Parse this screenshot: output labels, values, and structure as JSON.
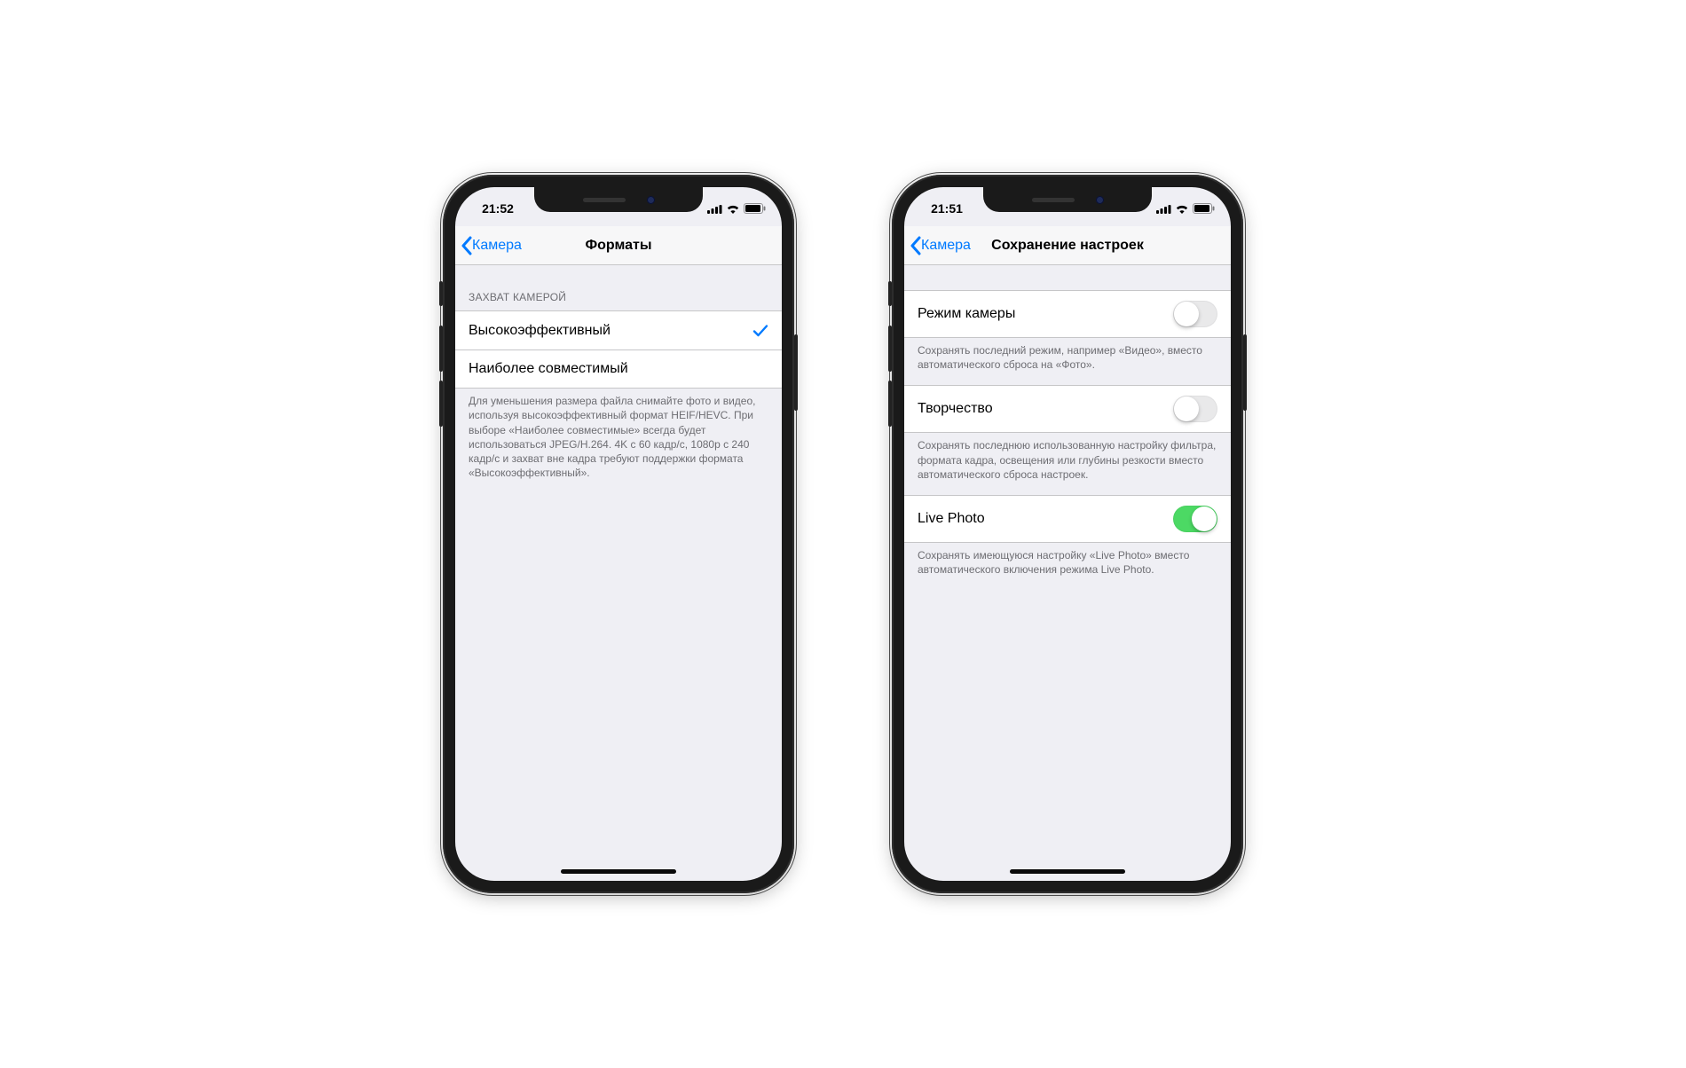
{
  "phone1": {
    "time": "21:52",
    "back_label": "Камера",
    "title": "Форматы",
    "group_header": "ЗАХВАТ КАМЕРОЙ",
    "options": [
      {
        "label": "Высокоэффективный",
        "selected": true
      },
      {
        "label": "Наиболее совместимый",
        "selected": false
      }
    ],
    "footer": "Для уменьшения размера файла снимайте фото и видео, используя высокоэффективный формат HEIF/HEVC. При выборе «Наиболее совместимые» всегда будет использоваться JPEG/H.264. 4K с 60 кадр/с, 1080p с 240 кадр/с и захват вне кадра требуют поддержки формата «Высокоэффективный»."
  },
  "phone2": {
    "time": "21:51",
    "back_label": "Камера",
    "title": "Сохранение настроек",
    "rows": [
      {
        "label": "Режим камеры",
        "on": false,
        "footer": "Сохранять последний режим, например «Видео», вместо автоматического сброса на «Фото»."
      },
      {
        "label": "Творчество",
        "on": false,
        "footer": "Сохранять последнюю использованную настройку фильтра, формата кадра, освещения или глубины резкости вместо автоматического сброса настроек."
      },
      {
        "label": "Live Photo",
        "on": true,
        "footer": "Сохранять имеющуюся настройку «Live Photo» вместо автоматического включения режима Live Photo."
      }
    ]
  },
  "colors": {
    "accent": "#007aff",
    "green": "#4cd964"
  }
}
